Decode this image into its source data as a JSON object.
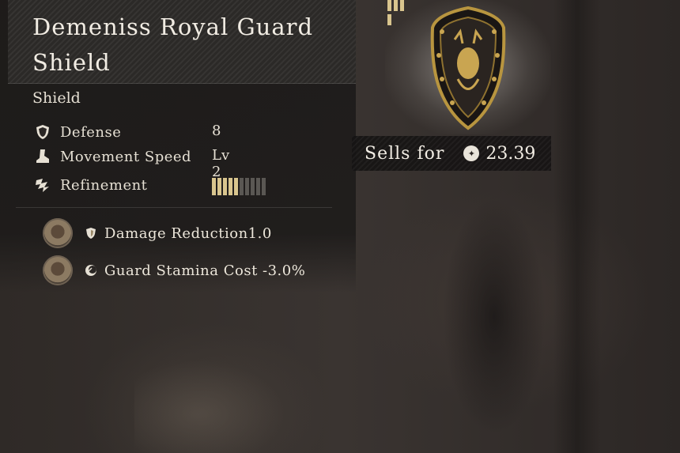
{
  "item": {
    "name": "Demeniss Royal Guard Shield",
    "type": "Shield",
    "image_icon": "crest-shield-icon"
  },
  "stats": [
    {
      "icon": "shield-icon",
      "label": "Defense",
      "value": "8"
    },
    {
      "icon": "boot-icon",
      "label": "Movement Speed",
      "value": "Lv 2"
    },
    {
      "icon": "refinement-icon",
      "label": "Refinement",
      "value": ""
    }
  ],
  "refinement": {
    "filled": 5,
    "total": 10
  },
  "effects": [
    {
      "icon": "shield-small-icon",
      "text": "Damage Reduction1.0"
    },
    {
      "icon": "stamina-icon",
      "text": "Guard Stamina Cost -3.0%"
    }
  ],
  "sell": {
    "label": "Sells for",
    "currency_icon": "coin-icon",
    "value": "23.39"
  },
  "colors": {
    "accent": "#d9c58e",
    "panel": "#1c1a19",
    "text": "#e8e2d6"
  }
}
